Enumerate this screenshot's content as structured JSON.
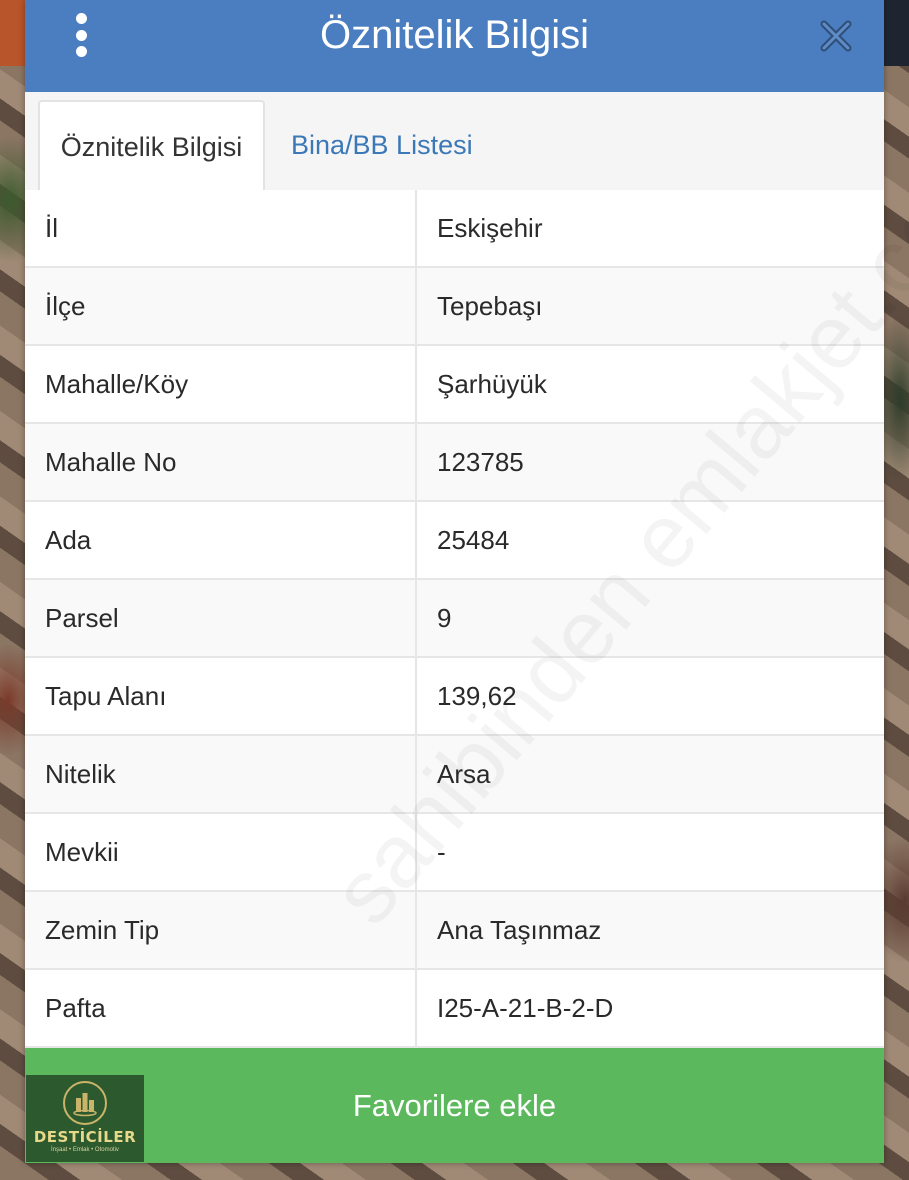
{
  "header": {
    "title": "Öznitelik Bilgisi"
  },
  "tabs": [
    {
      "label": "Öznitelik Bilgisi",
      "active": true
    },
    {
      "label": "Bina/BB Listesi",
      "active": false
    }
  ],
  "attributes": [
    {
      "label": "İl",
      "value": "Eskişehir"
    },
    {
      "label": "İlçe",
      "value": "Tepebaşı"
    },
    {
      "label": "Mahalle/Köy",
      "value": "Şarhüyük"
    },
    {
      "label": "Mahalle No",
      "value": "123785"
    },
    {
      "label": "Ada",
      "value": "25484"
    },
    {
      "label": "Parsel",
      "value": "9"
    },
    {
      "label": "Tapu Alanı",
      "value": "139,62"
    },
    {
      "label": "Nitelik",
      "value": "Arsa"
    },
    {
      "label": "Mevkii",
      "value": "-"
    },
    {
      "label": "Zemin Tip",
      "value": "Ana Taşınmaz"
    },
    {
      "label": "Pafta",
      "value": "I25-A-21-B-2-D"
    }
  ],
  "footer": {
    "favorite_label": "Favorilere ekle"
  },
  "logo": {
    "name": "DESTİCİLER",
    "tagline": "İnşaat • Emlak • Otomotiv"
  },
  "watermark": "sahibinden emlakjet.com",
  "colors": {
    "header": "#4a7ec0",
    "footer_button": "#5cb85c",
    "tab_link": "#3b78b8"
  },
  "icons": {
    "menu": "more-vertical-icon",
    "close": "close-icon"
  }
}
